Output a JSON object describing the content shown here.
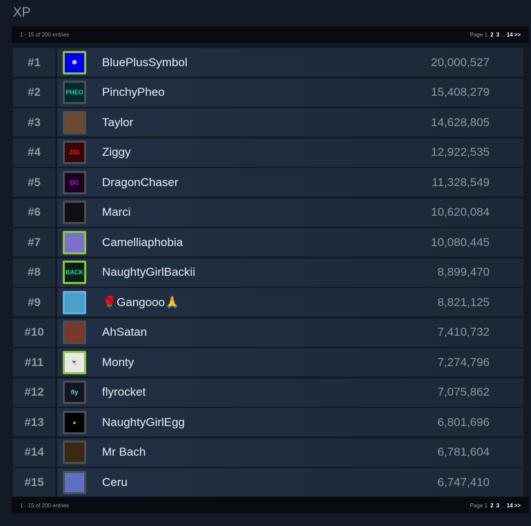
{
  "title": "XP",
  "pagination": {
    "summary": "1 - 15 of 200 entries",
    "page_label": "Page 1",
    "pages": [
      "2",
      "3"
    ],
    "ellipsis": "...",
    "last": "14",
    "next": ">>"
  },
  "entries": [
    {
      "rank": "#1",
      "name": "BluePlusSymbol",
      "xp": "20,000,527",
      "border": "#8bc53f",
      "bg": "#0000ee",
      "glyph": "⊕",
      "fg": "#fff"
    },
    {
      "rank": "#2",
      "name": "PinchyPheo",
      "xp": "15,408,279",
      "border": "#4b4f55",
      "bg": "#062a2a",
      "glyph": "PHEO",
      "fg": "#1fd1c0"
    },
    {
      "rank": "#3",
      "name": "Taylor",
      "xp": "14,628,805",
      "border": "#4b4f55",
      "bg": "#6b4a30",
      "glyph": "",
      "fg": "#fff"
    },
    {
      "rank": "#4",
      "name": "Ziggy",
      "xp": "12,922,535",
      "border": "#4b4f55",
      "bg": "#3a0505",
      "glyph": "ZIG",
      "fg": "#f22"
    },
    {
      "rank": "#5",
      "name": "DragonChaser",
      "xp": "11,328,549",
      "border": "#4b4f55",
      "bg": "#1a0020",
      "glyph": "DC",
      "fg": "#c020e0"
    },
    {
      "rank": "#6",
      "name": "Marci",
      "xp": "10,620,084",
      "border": "#4b4f55",
      "bg": "#101010",
      "glyph": "",
      "fg": "#d05020"
    },
    {
      "rank": "#7",
      "name": "Camelliaphobia",
      "xp": "10,080,445",
      "border": "#8bc53f",
      "bg": "#7c70c8",
      "glyph": "",
      "fg": "#fff"
    },
    {
      "rank": "#8",
      "name": "NaughtyGirlBackii",
      "xp": "8,899,470",
      "border": "#8bc53f",
      "bg": "#052018",
      "glyph": "BACK",
      "fg": "#2fe0a0"
    },
    {
      "rank": "#9",
      "name": "🌹Gangooo🙏",
      "xp": "8,821,125",
      "border": "#6aa9e0",
      "bg": "#4aa0c8",
      "glyph": "",
      "fg": "#fff"
    },
    {
      "rank": "#10",
      "name": "AhSatan",
      "xp": "7,410,732",
      "border": "#4b4f55",
      "bg": "#7a3828",
      "glyph": "",
      "fg": "#fff"
    },
    {
      "rank": "#11",
      "name": "Monty",
      "xp": "7,274,796",
      "border": "#8bc53f",
      "bg": "#e8e8e8",
      "glyph": "👻",
      "fg": "#000"
    },
    {
      "rank": "#12",
      "name": "flyrocket",
      "xp": "7,075,862",
      "border": "#4b4f55",
      "bg": "#151520",
      "glyph": "fly",
      "fg": "#60d0f0"
    },
    {
      "rank": "#13",
      "name": "NaughtyGirlEgg",
      "xp": "6,801,696",
      "border": "#4b4f55",
      "bg": "#000",
      "glyph": "●",
      "fg": "#e89050"
    },
    {
      "rank": "#14",
      "name": "Mr Bach",
      "xp": "6,781,604",
      "border": "#4b4f55",
      "bg": "#3a2a10",
      "glyph": "",
      "fg": "#fff"
    },
    {
      "rank": "#15",
      "name": "Ceru",
      "xp": "6,747,410",
      "border": "#4b4f55",
      "bg": "#6070c0",
      "glyph": "",
      "fg": "#fff"
    }
  ]
}
